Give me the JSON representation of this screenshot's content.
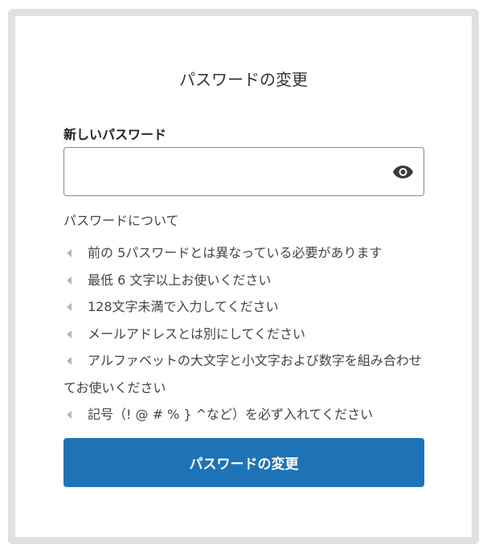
{
  "page": {
    "title": "パスワードの変更"
  },
  "form": {
    "new_password_label": "新しいパスワード",
    "new_password_value": "",
    "toggle_icon": "eye-icon"
  },
  "info": {
    "heading": "パスワードについて",
    "rules": [
      "前の 5パスワードとは異なっている必要があります",
      "最低 6 文字以上お使いください",
      "128文字未満で入力してください",
      "メールアドレスとは別にしてください",
      "アルファベットの大文字と小文字および数字を組み合わせてお使いください",
      "記号（! @ # % } ^など）を必ず入れてください"
    ],
    "marker_icon": "triangle-left-icon"
  },
  "actions": {
    "submit_label": "パスワードの変更"
  },
  "colors": {
    "accent": "#1e73b6",
    "frame": "#e0e0e0",
    "input_border": "#8a8a8a",
    "marker": "#b5b5b5"
  }
}
